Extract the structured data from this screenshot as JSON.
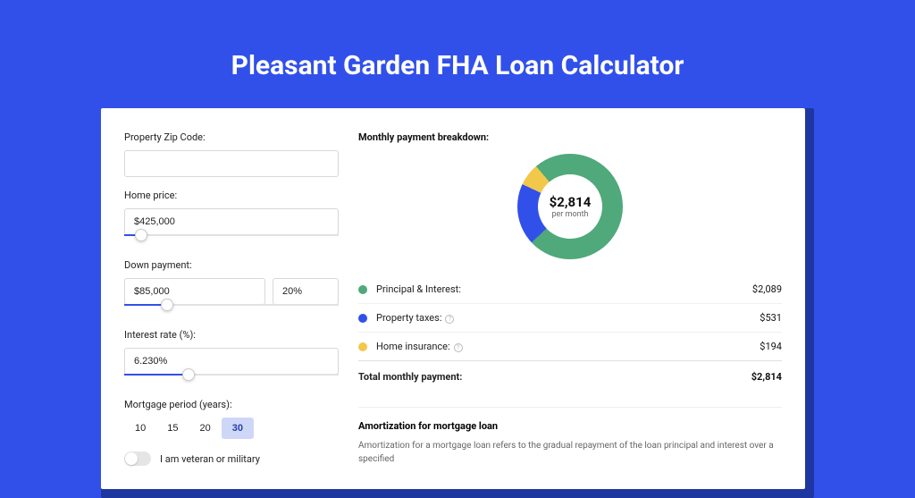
{
  "title": "Pleasant Garden FHA Loan Calculator",
  "colors": {
    "principal": "#4FA97B",
    "taxes": "#3150EA",
    "insurance": "#F2C84B"
  },
  "form": {
    "zip": {
      "label": "Property Zip Code:",
      "value": ""
    },
    "homePrice": {
      "label": "Home price:",
      "value": "$425,000",
      "sliderPct": 8
    },
    "downPayment": {
      "label": "Down payment:",
      "value": "$85,000",
      "pct": "20%",
      "sliderPct": 20
    },
    "interest": {
      "label": "Interest rate (%):",
      "value": "6.230%",
      "sliderPct": 30
    },
    "period": {
      "label": "Mortgage period (years):",
      "options": [
        "10",
        "15",
        "20",
        "30"
      ],
      "selected": "30"
    },
    "veteran": {
      "label": "I am veteran or military",
      "checked": false
    }
  },
  "breakdown": {
    "title": "Monthly payment breakdown:",
    "center": {
      "value": "$2,814",
      "sub": "per month"
    },
    "items": [
      {
        "key": "principal",
        "label": "Principal & Interest:",
        "value": "$2,089",
        "info": false
      },
      {
        "key": "taxes",
        "label": "Property taxes:",
        "value": "$531",
        "info": true
      },
      {
        "key": "insurance",
        "label": "Home insurance:",
        "value": "$194",
        "info": true
      }
    ],
    "total": {
      "label": "Total monthly payment:",
      "value": "$2,814"
    }
  },
  "amort": {
    "title": "Amortization for mortgage loan",
    "text": "Amortization for a mortgage loan refers to the gradual repayment of the loan principal and interest over a specified"
  },
  "chart_data": {
    "type": "pie",
    "title": "Monthly payment breakdown",
    "categories": [
      "Principal & Interest",
      "Property taxes",
      "Home insurance"
    ],
    "values": [
      2089,
      531,
      194
    ],
    "total": 2814
  }
}
